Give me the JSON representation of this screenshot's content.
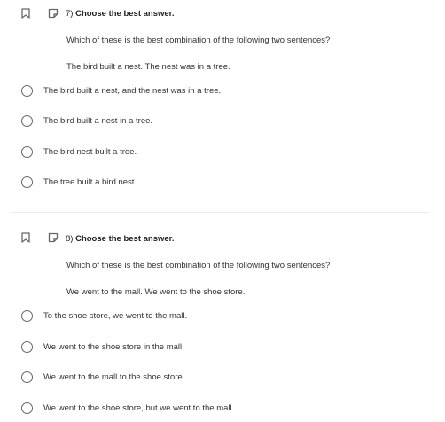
{
  "questions": [
    {
      "number": "7)",
      "instruction": "Choose the best answer.",
      "prompt": "Which of these is the best combination of the following two sentences?",
      "sentences": "The bird built a nest. The nest was in a tree.",
      "options": [
        "The bird built a nest, and the nest was in a tree.",
        "The bird built a nest in a tree.",
        "The bird nest built a tree.",
        "The tree built a bird nest."
      ]
    },
    {
      "number": "8)",
      "instruction": "Choose the best answer.",
      "prompt": "Which of these is the best combination of the following two sentences?",
      "sentences": "We went to the mall. We went to the shoe store.",
      "options": [
        "To the shoe store, we went to the mall.",
        "We went to the shoe store in the mall.",
        "We went to the mall to the shoe store.",
        "We went to the shoe store, but we went to the mall."
      ]
    }
  ]
}
